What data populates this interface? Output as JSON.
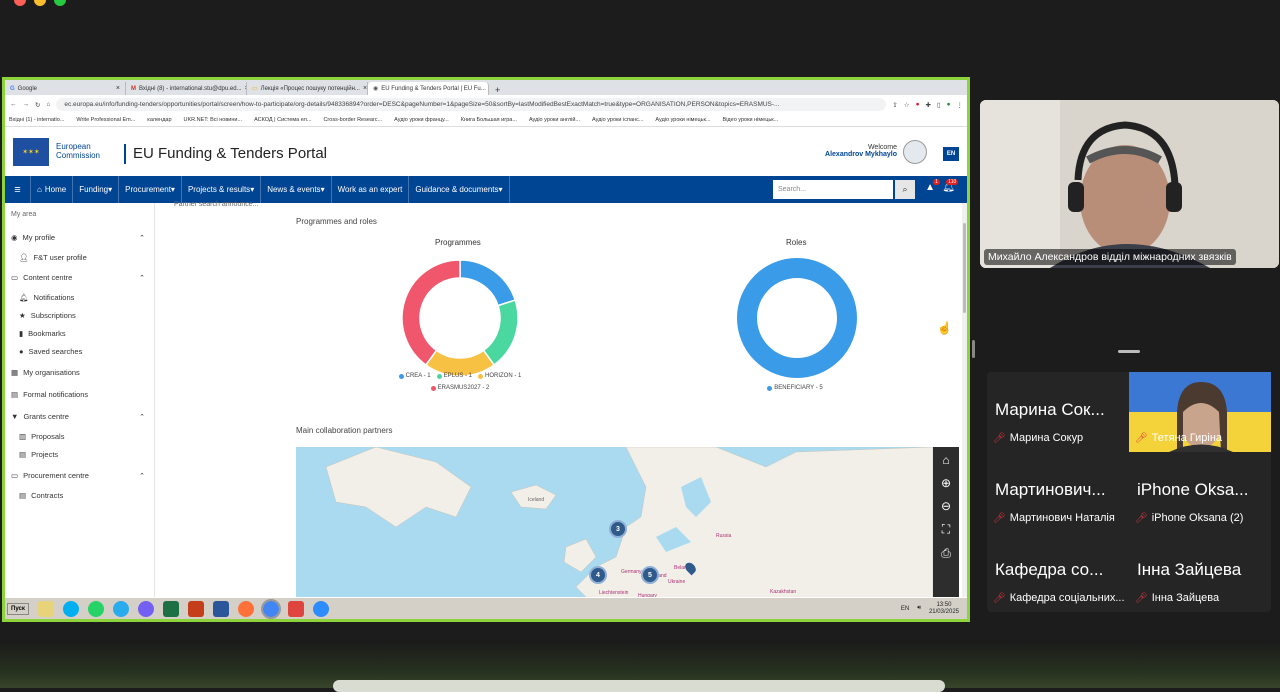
{
  "browser": {
    "tabs": [
      {
        "label": "Google",
        "icon": "google-icon"
      },
      {
        "label": "Вхідні (8) - international.stu@dpu.ed...",
        "icon": "gmail-icon"
      },
      {
        "label": "Лекція «Процес пошуку потенційн...",
        "icon": "doc-icon"
      },
      {
        "label": "EU Funding & Tenders Portal | EU Fu...",
        "icon": "eu-icon"
      }
    ],
    "url": "ec.europa.eu/info/funding-tenders/opportunities/portal/screen/how-to-participate/org-details/948336894?order=DESC&pageNumber=1&pageSize=50&sortBy=lastModifiedBestExactMatch=true&type=ORGANISATION,PERSON&topics=ERASMUS-...",
    "bookmarks": [
      "Вхідні (1) - internatio...",
      "Write Professional Em...",
      "календар",
      "UKR.NET: Всі новини...",
      "АСКОД | Система ел...",
      "Cross-border Researc...",
      "Аудіо уроки францу...",
      "Книга Большая игра...",
      "Аудіо уроки англій...",
      "Аудіо уроки іспанс...",
      "Аудіо уроки німецьк...",
      "Відео уроки німецьк..."
    ]
  },
  "portal": {
    "logo_line1": "European",
    "logo_line2": "Commission",
    "title": "EU Funding & Tenders Portal",
    "welcome": "Welcome",
    "user": "Alexandrov Mykhaylo",
    "lang": "EN",
    "nav": [
      "Home",
      "Funding",
      "Procurement",
      "Projects & results",
      "News & events",
      "Work as an expert",
      "Guidance & documents"
    ],
    "search_placeholder": "Search...",
    "bell_count": "110",
    "warn_count": "1"
  },
  "sidebar": {
    "my_area": "My area",
    "items": [
      {
        "label": "My profile",
        "level": 0
      },
      {
        "label": "F&T user profile",
        "level": 1
      },
      {
        "label": "Content centre",
        "level": 0
      },
      {
        "label": "Notifications",
        "level": 1
      },
      {
        "label": "Subscriptions",
        "level": 1
      },
      {
        "label": "Bookmarks",
        "level": 1
      },
      {
        "label": "Saved searches",
        "level": 1
      },
      {
        "label": "My organisations",
        "level": 0
      },
      {
        "label": "Formal notifications",
        "level": 0
      },
      {
        "label": "Grants centre",
        "level": 0
      },
      {
        "label": "Proposals",
        "level": 1
      },
      {
        "label": "Projects",
        "level": 1
      },
      {
        "label": "Procurement centre",
        "level": 0
      },
      {
        "label": "Contracts",
        "level": 1
      }
    ]
  },
  "main": {
    "partner_tab": "Partner search announce...",
    "section_title": "Programmes and roles",
    "collab_title": "Main collaboration partners",
    "map_labels": {
      "iceland": "Iceland",
      "russia": "Russia",
      "ukraine": "Ukraine",
      "kazakhstan": "Kazakhstan",
      "poland": "Poland",
      "germany": "Germany",
      "liechtenstein": "Liechtenstein",
      "hungary": "Hungary",
      "belarus": "Belarus"
    }
  },
  "chart_data": [
    {
      "type": "pie",
      "title": "Programmes",
      "categories": [
        "CREA",
        "EPLUS",
        "HORIZON",
        "ERASMUS2027"
      ],
      "values": [
        1,
        1,
        1,
        2
      ],
      "legend": [
        "CREA - 1",
        "EPLUS - 1",
        "HORIZON - 1",
        "ERASMUS2027 - 2"
      ],
      "colors": [
        "#3a9be8",
        "#4bd7a0",
        "#f7c143",
        "#f0576c"
      ]
    },
    {
      "type": "pie",
      "title": "Roles",
      "categories": [
        "BENEFICIARY"
      ],
      "values": [
        5
      ],
      "legend": [
        "BENEFICIARY - 5"
      ],
      "colors": [
        "#3a9be8"
      ]
    }
  ],
  "map_clusters": [
    "3",
    "4",
    "5"
  ],
  "taskbar": {
    "start": "Пуск",
    "lang": "EN",
    "time": "13:50",
    "date": "21/03/2025"
  },
  "zoom": {
    "speaker": "Михайло Александров відділ міжнародних звязків",
    "participants": [
      {
        "big": "Марина Сок...",
        "label": "Марина Сокур",
        "video": false
      },
      {
        "big": "",
        "label": "Тетяна Гиріна",
        "video": true
      },
      {
        "big": "Мартинович...",
        "label": "Мартинович Наталія",
        "video": false
      },
      {
        "big": "iPhone Oksa...",
        "label": "iPhone Oksana (2)",
        "video": false
      },
      {
        "big": "Кафедра со...",
        "label": "Кафедра соціальних...",
        "video": false
      },
      {
        "big": "Інна Зайцева",
        "label": "Інна Зайцева",
        "video": false
      }
    ]
  }
}
